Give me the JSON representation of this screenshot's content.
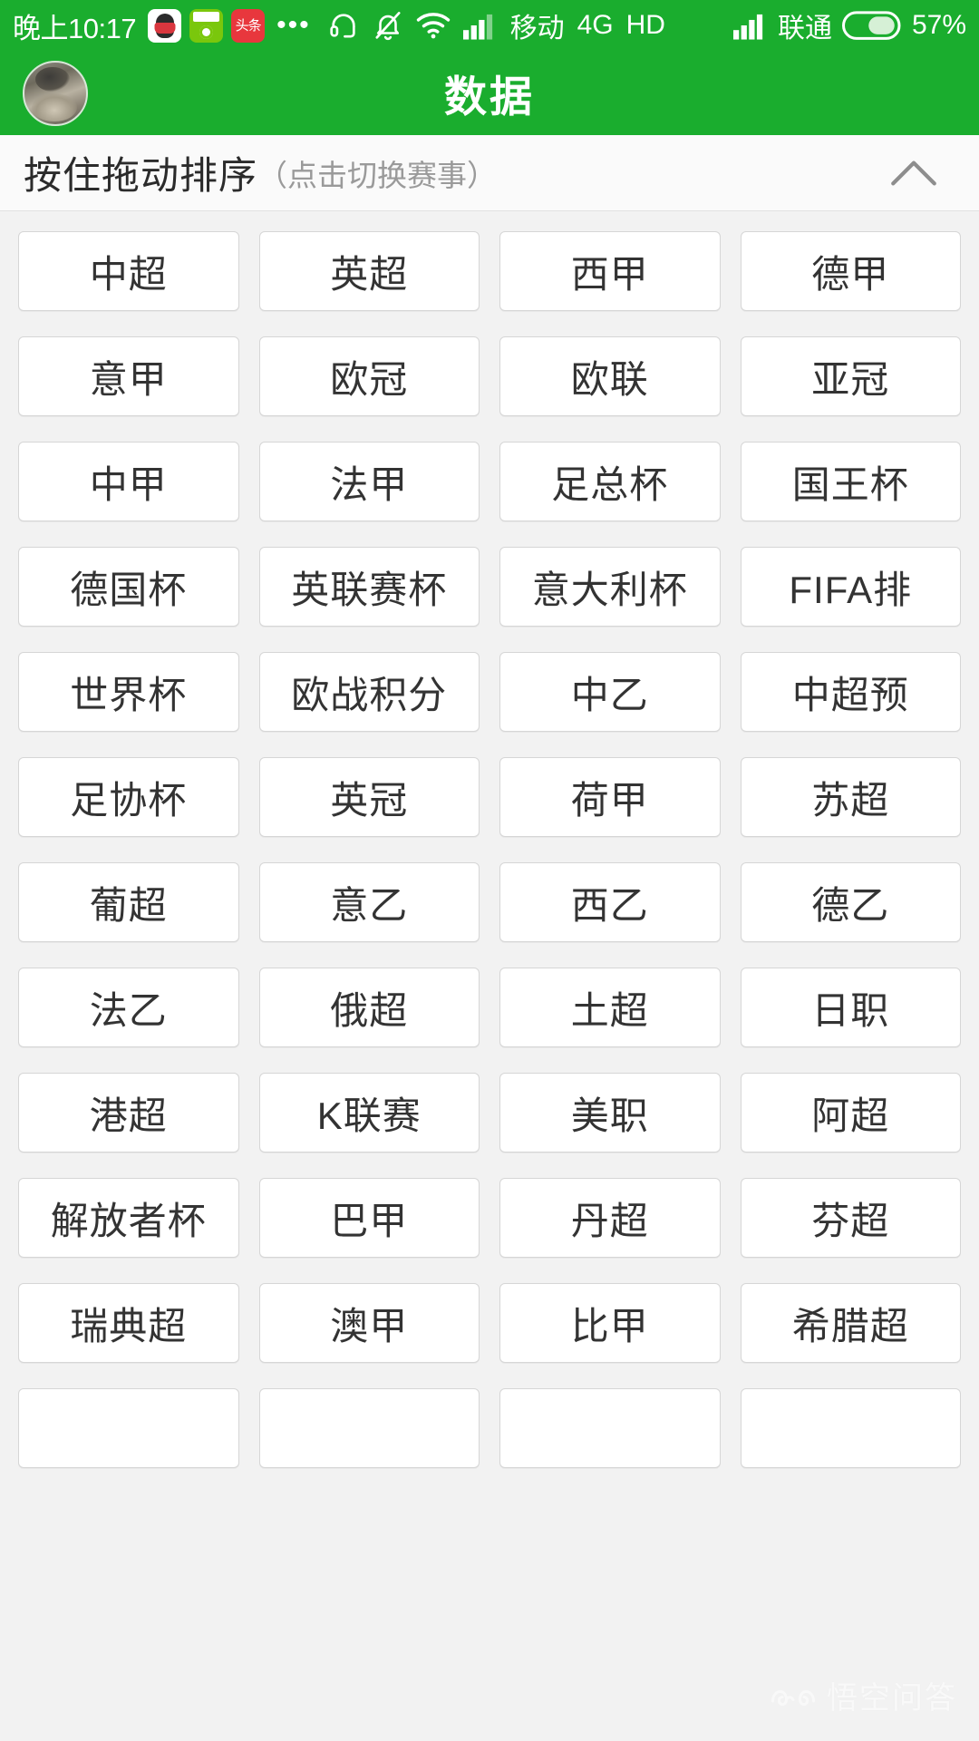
{
  "statusbar": {
    "time": "晚上10:17",
    "app_icons": [
      "qq-icon",
      "soccer-app-icon",
      "toutiao-icon"
    ],
    "overflow_dots": "•••",
    "icons": [
      "headset-icon",
      "bell-muted-icon",
      "wifi-icon",
      "signal-bars-icon"
    ],
    "carrier_primary": "移动",
    "network_type": "4G",
    "volte": "HD",
    "carrier_secondary": "联通",
    "battery_percent": "57%"
  },
  "titlebar": {
    "avatar": "user-avatar",
    "title": "数据"
  },
  "sortbar": {
    "main_label": "按住拖动排序",
    "sub_label": "（点击切换赛事）",
    "collapse_icon": "chevron-up-icon"
  },
  "grid": {
    "columns": 4,
    "items": [
      "中超",
      "英超",
      "西甲",
      "德甲",
      "意甲",
      "欧冠",
      "欧联",
      "亚冠",
      "中甲",
      "法甲",
      "足总杯",
      "国王杯",
      "德国杯",
      "英联赛杯",
      "意大利杯",
      "FIFA排",
      "世界杯",
      "欧战积分",
      "中乙",
      "中超预",
      "足协杯",
      "英冠",
      "荷甲",
      "苏超",
      "葡超",
      "意乙",
      "西乙",
      "德乙",
      "法乙",
      "俄超",
      "土超",
      "日职",
      "港超",
      "K联赛",
      "美职",
      "阿超",
      "解放者杯",
      "巴甲",
      "丹超",
      "芬超",
      "瑞典超",
      "澳甲",
      "比甲",
      "希腊超",
      "",
      "",
      "",
      ""
    ]
  },
  "watermark": {
    "logo": "wukong-logo-icon",
    "text": "悟空问答"
  },
  "colors": {
    "brand_green": "#1aad2e",
    "page_background": "#f2f2f2",
    "cell_background": "#ffffff",
    "cell_border": "#d6d6d6",
    "text_primary": "#333333",
    "text_muted": "#9a9a9a"
  }
}
